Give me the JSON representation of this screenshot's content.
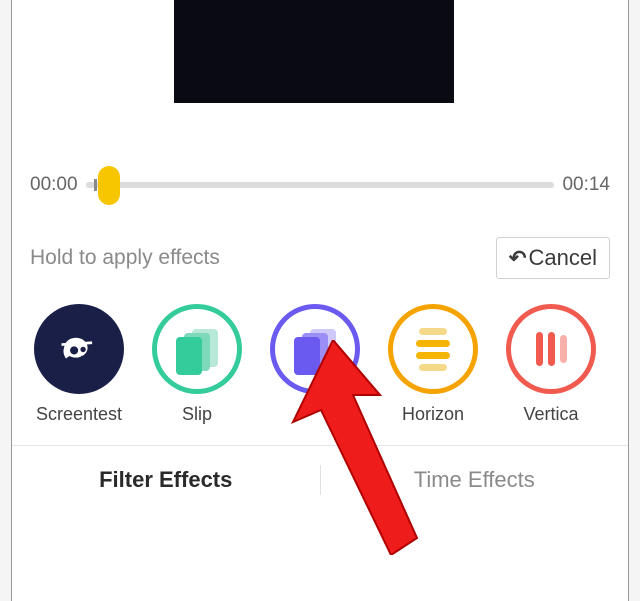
{
  "timeline": {
    "start": "00:00",
    "end": "00:14"
  },
  "hint": "Hold to apply effects",
  "cancel_label": "Cancel",
  "effects": {
    "screentest": "Screentest",
    "slip": "Slip",
    "horizon": "Horizon",
    "vertical": "Vertica"
  },
  "tabs": {
    "filter": "Filter Effects",
    "time": "Time Effects"
  }
}
